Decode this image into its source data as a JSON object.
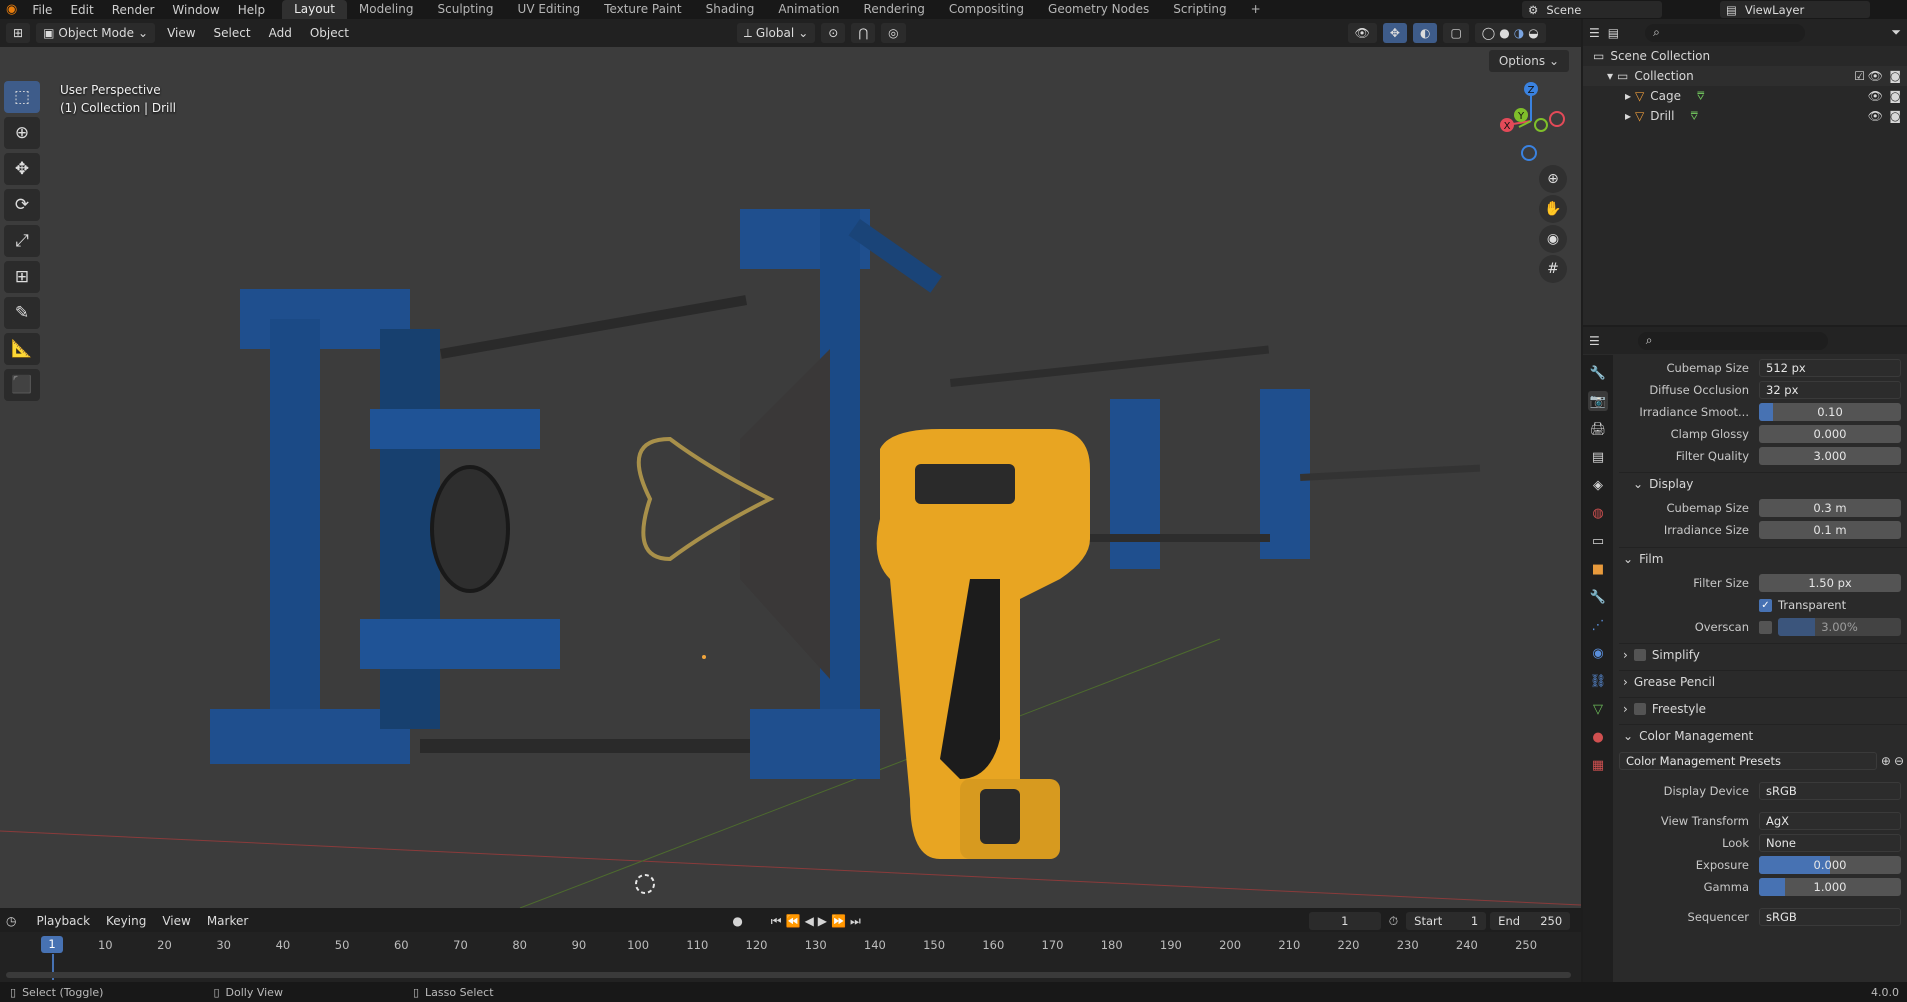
{
  "app": {
    "menu": [
      "File",
      "Edit",
      "Render",
      "Window",
      "Help"
    ],
    "workspaces": [
      "Layout",
      "Modeling",
      "Sculpting",
      "UV Editing",
      "Texture Paint",
      "Shading",
      "Animation",
      "Rendering",
      "Compositing",
      "Geometry Nodes",
      "Scripting"
    ],
    "active_workspace": "Layout",
    "scene": "Scene",
    "view_layer": "ViewLayer"
  },
  "viewport": {
    "mode": "Object Mode",
    "menus": [
      "View",
      "Select",
      "Add",
      "Object"
    ],
    "transform_orientation": "Global",
    "options": "Options",
    "perspective_label": "User Perspective",
    "collection_label": "(1) Collection | Drill",
    "gizmo_axes": {
      "x": "X",
      "y": "Y",
      "z": "Z"
    },
    "colors": {
      "x": "#e34a58",
      "y": "#7fbf2a",
      "z": "#3a82e0",
      "accent": "#4772b3"
    }
  },
  "outliner": {
    "root": "Scene Collection",
    "collection": "Collection",
    "objects": [
      "Cage",
      "Drill"
    ]
  },
  "properties": {
    "rows": [
      {
        "label": "Cubemap Size",
        "value": "512 px",
        "kind": "drop"
      },
      {
        "label": "Diffuse Occlusion",
        "value": "32 px",
        "kind": "drop"
      },
      {
        "label": "Irradiance Smoot...",
        "value": "0.10",
        "kind": "slider",
        "fill": 0.1
      },
      {
        "label": "Clamp Glossy",
        "value": "0.000",
        "kind": "num"
      },
      {
        "label": "Filter Quality",
        "value": "3.000",
        "kind": "num"
      }
    ],
    "display_section": "Display",
    "display_rows": [
      {
        "label": "Cubemap Size",
        "value": "0.3 m"
      },
      {
        "label": "Irradiance Size",
        "value": "0.1 m"
      }
    ],
    "film_section": "Film",
    "filter_size_label": "Filter Size",
    "filter_size": "1.50 px",
    "transparent_label": "Transparent",
    "overscan_label": "Overscan",
    "overscan": "3.00%",
    "collapsed_sections": [
      "Simplify",
      "Grease Pencil",
      "Freestyle"
    ],
    "color_mgmt_section": "Color Management",
    "presets": "Color Management Presets",
    "cm_rows": [
      {
        "label": "Display Device",
        "value": "sRGB"
      },
      {
        "label": "View Transform",
        "value": "AgX"
      },
      {
        "label": "Look",
        "value": "None"
      }
    ],
    "exposure_label": "Exposure",
    "exposure": "0.000",
    "gamma_label": "Gamma",
    "gamma": "1.000",
    "sequencer_label": "Sequencer",
    "sequencer": "sRGB"
  },
  "timeline": {
    "menus": [
      "Playback",
      "Keying",
      "View",
      "Marker"
    ],
    "current_frame": "1",
    "start_label": "Start",
    "start": "1",
    "end_label": "End",
    "end": "250",
    "ticks": [
      "10",
      "20",
      "30",
      "40",
      "50",
      "60",
      "70",
      "80",
      "90",
      "100",
      "110",
      "120",
      "130",
      "140",
      "150",
      "160",
      "170",
      "180",
      "190",
      "200",
      "210",
      "220",
      "230",
      "240",
      "250"
    ]
  },
  "status": {
    "left": "Select (Toggle)",
    "middle": "Dolly View",
    "right": "Lasso Select",
    "version": "4.0.0"
  }
}
